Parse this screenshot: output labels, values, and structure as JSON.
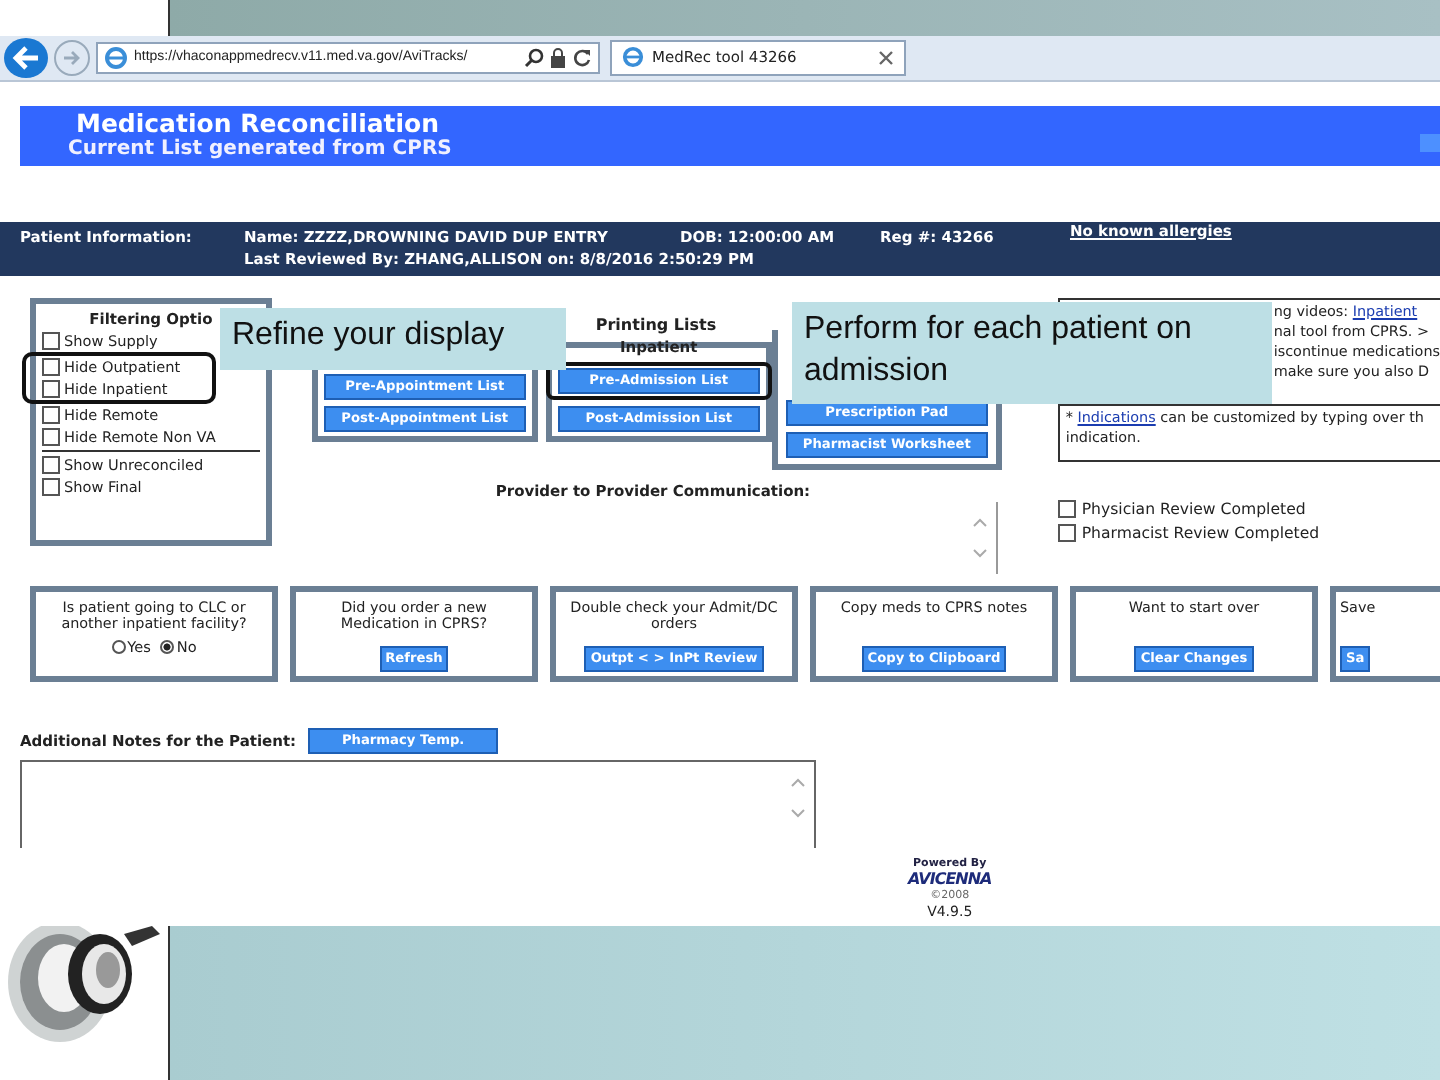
{
  "browser": {
    "address": "https://vhaconappmedrecv.v11.med.va.gov/AviTracks/",
    "tab_title": "MedRec tool 43266"
  },
  "header": {
    "title": "Medication Reconciliation",
    "subtitle": "Current List generated from CPRS"
  },
  "patient_bar": {
    "label": "Patient Information:",
    "name": "Name: ZZZZ,DROWNING DAVID DUP ENTRY",
    "dob": "DOB: 12:00:00 AM",
    "reg": "Reg #: 43266",
    "allergies": "No known allergies",
    "last_reviewed": "Last Reviewed By: ZHANG,ALLISON on: 8/8/2016 2:50:29 PM"
  },
  "filter_options": {
    "title": "Filtering Optio",
    "items": [
      {
        "label": "Show Supply",
        "checked": false
      },
      {
        "label": "Hide Outpatient",
        "checked": false
      },
      {
        "label": "Hide Inpatient",
        "checked": false
      },
      {
        "label": "Hide Remote",
        "checked": false
      },
      {
        "label": "Hide Remote Non VA",
        "checked": false
      }
    ],
    "items_2": [
      {
        "label": "Show Unreconciled",
        "checked": false
      },
      {
        "label": "Show Final",
        "checked": false
      }
    ]
  },
  "printing_lists": {
    "title": "Printing Lists",
    "outpatient_buttons": [
      "Pre-Appointment List",
      "Post-Appointment List"
    ],
    "inpatient_title": "Inpatient",
    "inpatient_buttons": [
      "Pre-Admission List",
      "Post-Admission List"
    ],
    "other_buttons": [
      "Prescription Pad",
      "Pharmacist Worksheet"
    ]
  },
  "info_box": {
    "lines": [
      [
        {
          "text": "ng videos: ",
          "link": false
        },
        {
          "text": "Inpatient",
          "link": true
        }
      ],
      [
        {
          "text": "nal tool from CPRS. >",
          "link": false
        }
      ],
      [
        {
          "text": "iscontinue medications",
          "link": false
        }
      ],
      [
        {
          "text": "make sure you also D",
          "link": false
        }
      ]
    ],
    "note": [
      {
        "text": "* ",
        "link": false
      },
      {
        "text": "Indications",
        "link": true
      },
      {
        "text": " can be customized by typing over th",
        "link": false
      }
    ],
    "note_2": "indication."
  },
  "provider_comm": {
    "label": "Provider to Provider Communication:"
  },
  "review_checks": [
    {
      "label": "Physician Review Completed",
      "checked": false
    },
    {
      "label": "Pharmacist Review Completed",
      "checked": false
    }
  ],
  "action_boxes": [
    {
      "kind": "radio",
      "prompt": "Is patient going to CLC or another inpatient facility?",
      "options": [
        {
          "label": "Yes",
          "selected": false
        },
        {
          "label": "No",
          "selected": true
        }
      ]
    },
    {
      "kind": "button",
      "prompt": "Did you order a new Medication in CPRS?",
      "button": "Refresh"
    },
    {
      "kind": "button",
      "prompt": "Double check your Admit/DC orders",
      "button": "Outpt < > InPt Review"
    },
    {
      "kind": "button",
      "prompt": "Copy meds to CPRS notes",
      "button": "Copy to Clipboard"
    },
    {
      "kind": "button",
      "prompt": "Want to start over",
      "button": "Clear Changes"
    },
    {
      "kind": "button",
      "prompt": "Save",
      "button": "Sa"
    }
  ],
  "notes": {
    "label": "Additional Notes for the Patient:",
    "button": "Pharmacy Temp."
  },
  "footer": {
    "powered_by": "Powered By",
    "logo": "AVICENNA",
    "copyright": "©2008",
    "version": "V4.9.5"
  },
  "callouts": [
    {
      "text": "Refine your display"
    },
    {
      "text": "Perform for each patient on admission"
    }
  ]
}
